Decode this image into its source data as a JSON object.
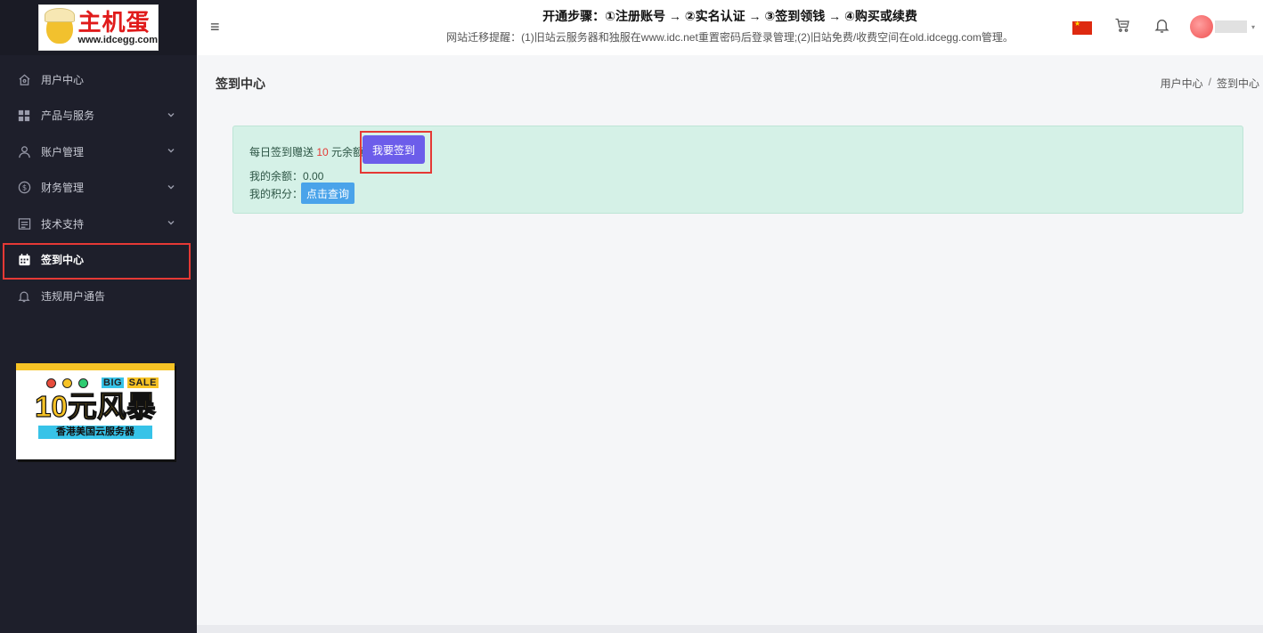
{
  "logo": {
    "brand": "主机蛋",
    "domain": "www.idcegg.com"
  },
  "sidebar": {
    "items": [
      {
        "label": "用户中心",
        "icon": "home-icon",
        "has_submenu": false,
        "active": false
      },
      {
        "label": "产品与服务",
        "icon": "grid-icon",
        "has_submenu": true,
        "active": false
      },
      {
        "label": "账户管理",
        "icon": "user-icon",
        "has_submenu": true,
        "active": false
      },
      {
        "label": "财务管理",
        "icon": "dollar-icon",
        "has_submenu": true,
        "active": false
      },
      {
        "label": "技术支持",
        "icon": "support-icon",
        "has_submenu": true,
        "active": false
      },
      {
        "label": "签到中心",
        "icon": "calendar-icon",
        "has_submenu": false,
        "active": true
      },
      {
        "label": "违规用户通告",
        "icon": "bell-icon",
        "has_submenu": false,
        "active": false
      }
    ]
  },
  "promo": {
    "big": "BIG",
    "sale": "SALE",
    "headline_main": "10元",
    "headline_accent": "风暴",
    "subtitle": "香港美国云服务器"
  },
  "header": {
    "notice_title": "开通步骤：①注册账号 → ②实名认证 → ③签到领钱 → ④购买或续费",
    "notice_sub": "网站迁移提醒：(1)旧站云服务器和独服在www.idc.net重置密码后登录管理;(2)旧站免费/收费空间在old.idcegg.com管理。",
    "flag": "china-flag-icon",
    "cart": "cart-icon",
    "bell": "bell-icon"
  },
  "page": {
    "title": "签到中心",
    "breadcrumb": [
      "用户中心",
      "签到中心"
    ],
    "breadcrumb_sep": "/"
  },
  "checkin": {
    "daily_prefix": "每日签到赠送 ",
    "daily_amount": "10",
    "daily_suffix": " 元余额",
    "button_label": "我要签到",
    "balance_label": "我的余额：",
    "balance_value": "0.00",
    "points_label": "我的积分：",
    "query_button_label": "点击查询"
  },
  "colors": {
    "sidebar_bg": "#1e1f2b",
    "accent": "#6c5dea",
    "query_btn": "#4aa3ea",
    "highlight": "#e53935",
    "checkin_bg": "#d5f1e7"
  }
}
